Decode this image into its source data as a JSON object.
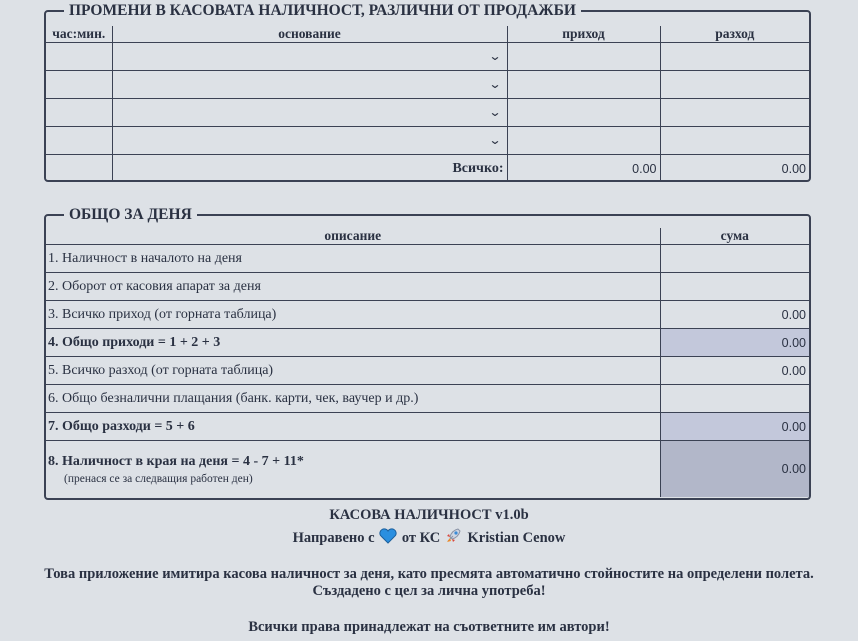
{
  "changes": {
    "legend": "ПРОМЕНИ В КАСОВАТА НАЛИЧНОСТ, РАЗЛИЧНИ ОТ ПРОДАЖБИ",
    "columns": [
      "час:мин.",
      "основание",
      "приход",
      "разход"
    ],
    "rows": [
      {
        "time": "",
        "reason": "",
        "income": "",
        "expense": ""
      },
      {
        "time": "",
        "reason": "",
        "income": "",
        "expense": ""
      },
      {
        "time": "",
        "reason": "",
        "income": "",
        "expense": ""
      },
      {
        "time": "",
        "reason": "",
        "income": "",
        "expense": ""
      }
    ],
    "total_label": "Всичко:",
    "total_income": "0.00",
    "total_expense": "0.00"
  },
  "daily": {
    "legend": "ОБЩО ЗА ДЕНЯ",
    "columns": [
      "описание",
      "сума"
    ],
    "rows": [
      {
        "label": "1. Наличност в началото на деня",
        "value": ""
      },
      {
        "label": "2. Оборот от касовия апарат за деня",
        "value": ""
      },
      {
        "label": "3. Всичко приход (от горната таблица)",
        "value": "0.00"
      },
      {
        "label": "4. Общо приходи = 1 + 2 + 3",
        "value": "0.00"
      },
      {
        "label": "5. Всичко разход (от горната таблица)",
        "value": "0.00"
      },
      {
        "label": "6. Общо безналични плащания (банк. карти, чек, ваучер и др.)",
        "value": ""
      },
      {
        "label": "7. Общо разходи = 5 + 6",
        "value": "0.00"
      },
      {
        "label": "8. Наличност в края на деня = 4 - 7 + 11*",
        "value": "0.00",
        "note": "(пренася се за следващия работен ден)"
      }
    ]
  },
  "footer": {
    "title": "КАСОВА НАЛИЧНОСТ v1.0b",
    "made_prefix": "Направено с",
    "made_mid": "от КС",
    "made_author": "Kristian Cenow",
    "description": "Това приложение имитира касова наличност за деня, като пресмята автоматично стойностите на определени полета.",
    "purpose": "Създадено с цел за лична употреба!",
    "rights": "Всички права принадлежат на съответните им автори!",
    "heart_color": "#2a8fe0"
  }
}
